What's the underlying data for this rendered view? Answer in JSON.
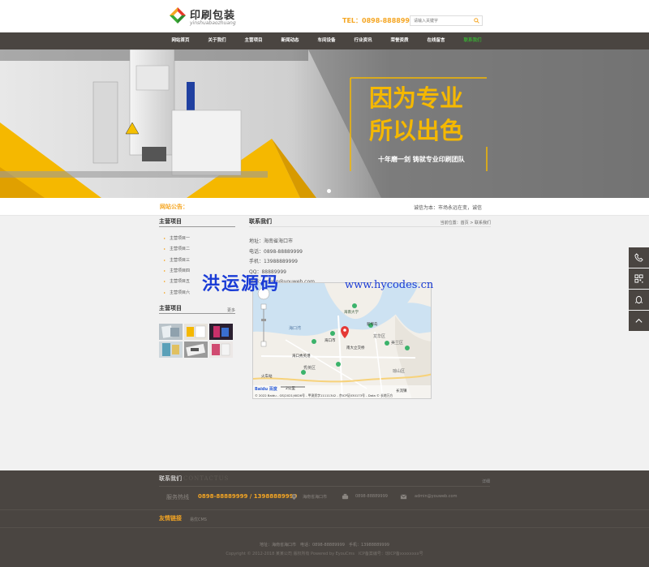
{
  "logo": {
    "cn": "印刷包装",
    "en": "yinshuabaozhuang"
  },
  "header": {
    "tel": "TEL：0898-88889999",
    "search_placeholder": "请输入关键字"
  },
  "nav": {
    "items": [
      "网站首页",
      "关于我们",
      "主营项目",
      "新闻动态",
      "车间设备",
      "行业资讯",
      "荣誉资质",
      "在线留言",
      "联系我们"
    ],
    "active_index": 8
  },
  "banner": {
    "line1": "因为专业",
    "line2": "所以出色",
    "sub": "十年磨一剑 铸就专业印刷团队"
  },
  "notice": {
    "label": "网站公告：",
    "text": "诚信为本：市场永远在变，诚信"
  },
  "sidebar": {
    "title": "主营项目",
    "items": [
      "主营项目一",
      "主营项目二",
      "主营项目三",
      "主营项目四",
      "主营项目五",
      "主营项目六"
    ],
    "title2": "主营项目",
    "more": "更多"
  },
  "content": {
    "title": "联系我们",
    "breadcrumb": "当前位置：首页 > 联系我们",
    "lines": [
      "地址：海南省海口市",
      "电话：0898-88889999",
      "手机：13988889999",
      "QQ：88889999",
      "邮箱：admin@youweb.com"
    ]
  },
  "map": {
    "labels": [
      "海南大学",
      "海口市",
      "南大立交桥",
      "海口秀英港",
      "秀英区",
      "琼山区",
      "美兰区",
      "海口湾",
      "龙华区",
      "新埠岛",
      "火车站",
      "长流镇"
    ],
    "scale": "2公里",
    "brand": "Baidu 百度",
    "copyright": "© 2022 Baidu - GS(2021)6026号 - 甲测资字11111342 - 京ICP证030173号 - Data © 长地万方"
  },
  "watermark": {
    "cn": "洪运源码",
    "url": "www.hycodes.cn"
  },
  "footer": {
    "title": "联系我们",
    "title_en": "CONTACTUS",
    "more": "详细",
    "hotline_label": "服务热线",
    "hotline": "0898-88889999 / 13988889999",
    "address": "海南省海口市",
    "tel": "0898-88889999",
    "email": "admin@youweb.com",
    "links_title": "友情链接",
    "link": "易优CMS",
    "addr_line": "地址：海南省海口市　电话：0898-88889999　手机：13988889999",
    "copyright": "Copyright © 2012-2018 某某公司 版权所有 Powered by EyouCms　ICP备案编号：琼ICP备xxxxxxxx号"
  },
  "colors": {
    "accent": "#f5a623",
    "nav_bg": "#4a4541",
    "nav_active": "#3aaa35",
    "watermark": "#1a3cd6"
  },
  "icons": {
    "search": "magnifier-icon",
    "float": [
      "phone-icon",
      "qrcode-icon",
      "qq-icon",
      "back-to-top-icon"
    ],
    "footer": [
      "location-icon",
      "phone-icon",
      "mail-icon"
    ]
  }
}
